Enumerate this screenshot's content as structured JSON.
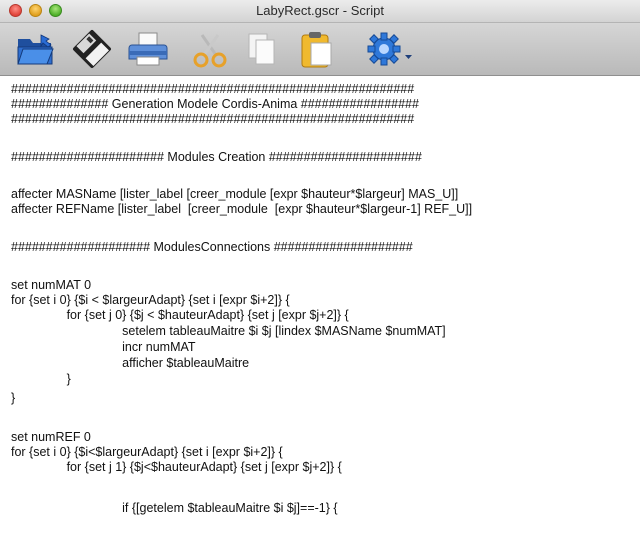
{
  "window": {
    "title": "LabyRect.gscr - Script"
  },
  "toolbar": {
    "buttons": [
      {
        "name": "open",
        "icon": "open-folder-icon"
      },
      {
        "name": "save",
        "icon": "floppy-disk-icon"
      },
      {
        "name": "print",
        "icon": "printer-icon"
      },
      {
        "name": "cut",
        "icon": "scissors-icon"
      },
      {
        "name": "copy",
        "icon": "copy-documents-icon"
      },
      {
        "name": "paste",
        "icon": "clipboard-icon"
      },
      {
        "name": "run-menu",
        "icon": "gear-dropdown-icon"
      }
    ]
  },
  "editor": {
    "lines": [
      "##########################################################",
      "############## Generation Modele Cordis-Anima #################",
      "##########################################################",
      "",
      "###################### Modules Creation ######################",
      "",
      "affecter MASName [lister_label [creer_module [expr $hauteur*$largeur] MAS_U]]",
      "affecter REFName [lister_label  [creer_module  [expr $hauteur*$largeur-1] REF_U]]",
      "",
      "#################### ModulesConnections ####################",
      "",
      "set numMAT 0",
      "for {set i 0} {$i < $largeurAdapt} {set i [expr $i+2]} {",
      "\t\tfor {set j 0} {$j < $hauteurAdapt} {set j [expr $j+2]} {",
      "\t\t\t\tsetelem tableauMaitre $i $j [lindex $MASName $numMAT]",
      "\t\t\t\tincr numMAT",
      "\t\t\t\tafficher $tableauMaitre",
      "\t\t}",
      "}",
      "",
      "set numREF 0",
      "for {set i 0} {$i<$largeurAdapt} {set i [expr $i+2]} {",
      "\t\tfor {set j 1} {$j<$hauteurAdapt} {set j [expr $j+2]} {",
      "",
      "\t\t\t\tif {[getelem $tableauMaitre $i $j]==-1} {"
    ]
  }
}
